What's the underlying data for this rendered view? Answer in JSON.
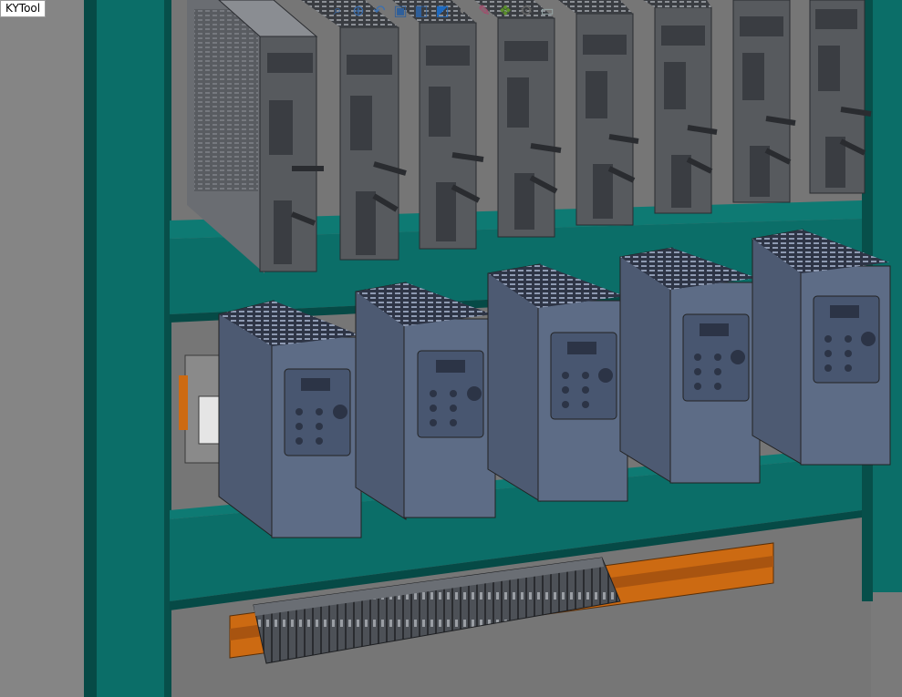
{
  "tooltip": {
    "label": "KYTool"
  },
  "toolbar": {
    "icons": [
      "zoom-fit-icon",
      "zoom-area-icon",
      "previous-view-icon",
      "section-view-icon",
      "view-orientation-icon",
      "display-style-icon",
      "hide-show-icon",
      "edit-appearance-icon",
      "apply-scene-icon",
      "view-settings-icon",
      "display-pane-icon"
    ]
  },
  "colors": {
    "cabinet": "#0b6e68",
    "background": "#7a7a7a",
    "servo": "#575a5e",
    "vfd": "#5d6c86",
    "din_rail": "#cc6a12",
    "terminals": "#4d5157"
  }
}
